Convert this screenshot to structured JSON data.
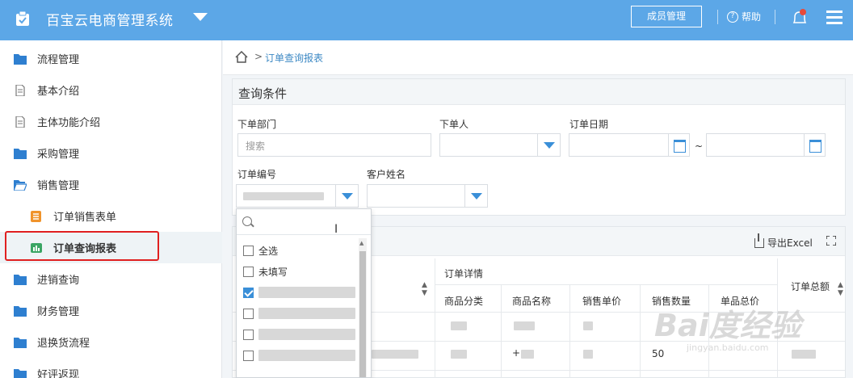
{
  "header": {
    "app_title": "百宝云电商管理系统",
    "members_button": "成员管理",
    "help_label": "帮助",
    "help_glyph": "?"
  },
  "sidebar": {
    "items": [
      {
        "label": "流程管理",
        "icon": "folder-icon"
      },
      {
        "label": "基本介绍",
        "icon": "document-icon"
      },
      {
        "label": "主体功能介绍",
        "icon": "document-icon"
      },
      {
        "label": "采购管理",
        "icon": "folder-icon"
      },
      {
        "label": "销售管理",
        "icon": "folder-open-icon"
      },
      {
        "label": "订单销售表单",
        "icon": "form-icon"
      },
      {
        "label": "订单查询报表",
        "icon": "bar-chart-icon"
      },
      {
        "label": "进销查询",
        "icon": "folder-icon"
      },
      {
        "label": "财务管理",
        "icon": "folder-icon"
      },
      {
        "label": "退换货流程",
        "icon": "folder-icon"
      },
      {
        "label": "好评返现",
        "icon": "folder-icon"
      }
    ],
    "active_item": "订单查询报表"
  },
  "breadcrumb": {
    "separator": ">",
    "current": "订单查询报表"
  },
  "query": {
    "title": "查询条件",
    "dept_label": "下单部门",
    "dept_placeholder": "搜索",
    "orderer_label": "下单人",
    "date_label": "订单日期",
    "date_separator": "~",
    "order_no_label": "订单编号",
    "customer_label": "客户姓名"
  },
  "results": {
    "export_label": "导出Excel",
    "group_header": "订单详情",
    "columns": [
      "商品分类",
      "商品名称",
      "销售单价",
      "销售数量",
      "单品总价"
    ],
    "total_column": "订单总额",
    "row2_quantity": "50",
    "row2_name_fragment": "+"
  },
  "dropdown": {
    "options": [
      {
        "label": "全选",
        "checked": false
      },
      {
        "label": "未填写",
        "checked": false
      },
      {
        "label": "",
        "checked": true
      },
      {
        "label": "",
        "checked": false
      },
      {
        "label": "",
        "checked": false
      },
      {
        "label": "",
        "checked": false
      }
    ]
  },
  "watermark": {
    "main": "Bai度经验",
    "sub": "jingyan.baidu.com"
  },
  "colors": {
    "header_bg": "#5ca7e7",
    "accent": "#3a8fd8",
    "highlight_box": "#e02020"
  }
}
